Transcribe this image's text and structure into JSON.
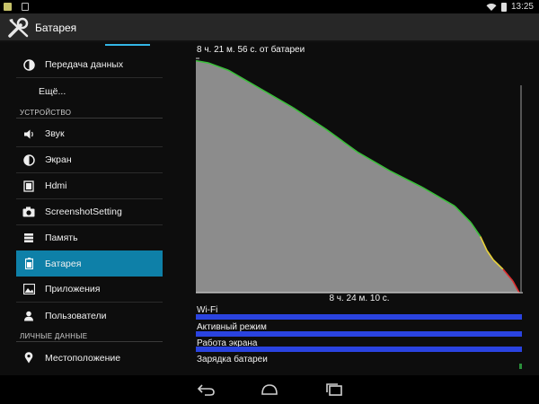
{
  "status_bar": {
    "time": "13:25"
  },
  "action_bar": {
    "title": "Батарея",
    "app_icon": "settings-tools-icon"
  },
  "sidebar": {
    "items": [
      {
        "label": "Передача данных",
        "icon": "data-usage-icon"
      },
      {
        "label": "Ещё..."
      },
      {
        "label": "Звук",
        "icon": "volume-icon"
      },
      {
        "label": "Экран",
        "icon": "brightness-icon"
      },
      {
        "label": "Hdmi",
        "icon": "hdmi-icon"
      },
      {
        "label": "ScreenshotSetting",
        "icon": "camera-icon"
      },
      {
        "label": "Память",
        "icon": "storage-icon"
      },
      {
        "label": "Батарея",
        "icon": "battery-icon",
        "active": true
      },
      {
        "label": "Приложения",
        "icon": "apps-icon"
      },
      {
        "label": "Пользователи",
        "icon": "users-icon"
      },
      {
        "label": "Местоположение",
        "icon": "location-icon"
      }
    ],
    "headers": [
      "УСТРОЙСТВО",
      "ЛИЧНЫЕ ДАННЫЕ"
    ],
    "accent_color": "#0e80a8"
  },
  "battery_history": {
    "title": "8 ч. 21 м. 56 с. от батареи",
    "x_label": "8 ч. 24 м. 10 с.",
    "signals": [
      {
        "label": "Wi-Fi"
      },
      {
        "label": "Активный режим"
      },
      {
        "label": "Работа экрана"
      },
      {
        "label": "Зарядка батареи"
      }
    ],
    "colors": {
      "fill": "#8c8c8c",
      "high": "#3bbf3b",
      "mid": "#e8d23a",
      "low": "#e03030",
      "signal": "#2a43e0"
    }
  },
  "chart_data": {
    "type": "area",
    "title": "8 ч. 21 м. 56 с. от батареи",
    "xlabel": "8 ч. 24 м. 10 с.",
    "ylabel": "",
    "x": [
      0,
      0.04,
      0.1,
      0.2,
      0.3,
      0.4,
      0.5,
      0.6,
      0.7,
      0.8,
      0.85,
      0.88,
      0.9,
      0.92,
      0.95,
      0.98,
      1.0
    ],
    "values": [
      99,
      98,
      95,
      87,
      79,
      70,
      60,
      52,
      45,
      37,
      30,
      24,
      18,
      14,
      10,
      5,
      0
    ],
    "ylim": [
      0,
      100
    ],
    "grid": false
  },
  "nav_bar": {
    "buttons": [
      "back-icon",
      "home-icon",
      "recents-icon"
    ]
  }
}
